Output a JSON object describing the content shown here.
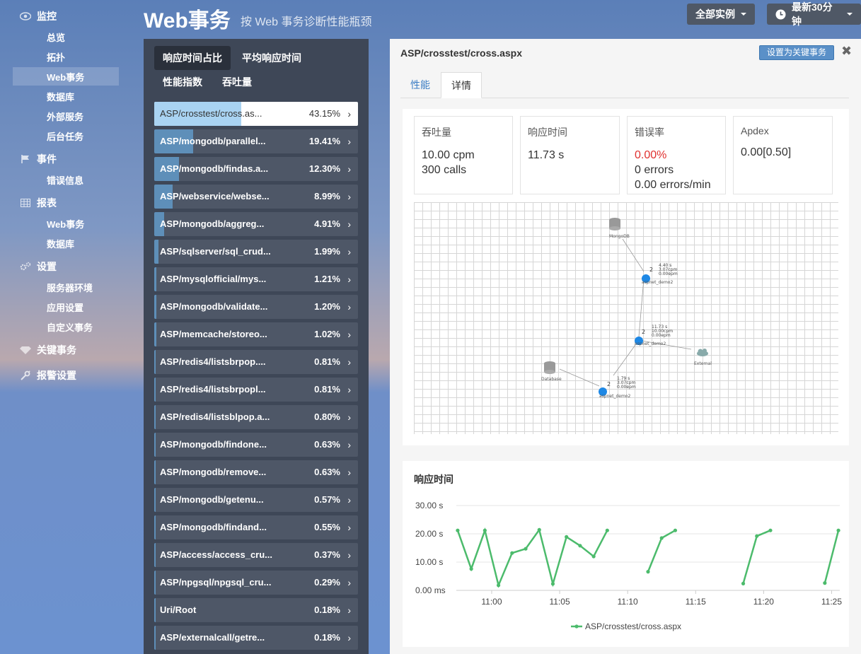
{
  "sidebar": {
    "groups": [
      {
        "label": "监控",
        "icon": "eye-icon"
      },
      {
        "label": "事件",
        "icon": "flag-icon"
      },
      {
        "label": "报表",
        "icon": "table-icon"
      },
      {
        "label": "设置",
        "icon": "gears-icon"
      },
      {
        "label": "关键事务",
        "icon": "diamond-icon"
      },
      {
        "label": "报警设置",
        "icon": "wrench-icon"
      }
    ],
    "items": [
      "总览",
      "拓扑",
      "Web事务",
      "数据库",
      "外部服务",
      "后台任务",
      "错误信息",
      "Web事务",
      "数据库",
      "服务器环境",
      "应用设置",
      "自定义事务"
    ],
    "active_item": "Web事务"
  },
  "header": {
    "title": "Web事务",
    "subtitle": "按 Web 事务诊断性能瓶颈",
    "instances_label": "全部实例",
    "time_label": "最新30分钟"
  },
  "list": {
    "tabs": [
      "响应时间占比",
      "平均响应时间",
      "性能指数",
      "吞吐量"
    ],
    "active_tab": "响应时间占比",
    "rows": [
      {
        "name": "ASP/crosstest/cross.as...",
        "pct": "43.15%",
        "value": 43.15
      },
      {
        "name": "ASP/mongodb/parallel...",
        "pct": "19.41%",
        "value": 19.41
      },
      {
        "name": "ASP/mongodb/findas.a...",
        "pct": "12.30%",
        "value": 12.3
      },
      {
        "name": "ASP/webservice/webse...",
        "pct": "8.99%",
        "value": 8.99
      },
      {
        "name": "ASP/mongodb/aggreg...",
        "pct": "4.91%",
        "value": 4.91
      },
      {
        "name": "ASP/sqlserver/sql_crud...",
        "pct": "1.99%",
        "value": 1.99
      },
      {
        "name": "ASP/mysqlofficial/mys...",
        "pct": "1.21%",
        "value": 1.21
      },
      {
        "name": "ASP/mongodb/validate...",
        "pct": "1.20%",
        "value": 1.2
      },
      {
        "name": "ASP/memcache/storeo...",
        "pct": "1.02%",
        "value": 1.02
      },
      {
        "name": "ASP/redis4/listsbrpop....",
        "pct": "0.81%",
        "value": 0.81
      },
      {
        "name": "ASP/redis4/listsbrpopl...",
        "pct": "0.81%",
        "value": 0.81
      },
      {
        "name": "ASP/redis4/listsblpop.a...",
        "pct": "0.80%",
        "value": 0.8
      },
      {
        "name": "ASP/mongodb/findone...",
        "pct": "0.63%",
        "value": 0.63
      },
      {
        "name": "ASP/mongodb/remove...",
        "pct": "0.63%",
        "value": 0.63
      },
      {
        "name": "ASP/mongodb/getenu...",
        "pct": "0.57%",
        "value": 0.57
      },
      {
        "name": "ASP/mongodb/findand...",
        "pct": "0.55%",
        "value": 0.55
      },
      {
        "name": "ASP/access/access_cru...",
        "pct": "0.37%",
        "value": 0.37
      },
      {
        "name": "ASP/npgsql/npgsql_cru...",
        "pct": "0.29%",
        "value": 0.29
      },
      {
        "name": "Uri/Root",
        "pct": "0.18%",
        "value": 0.18
      },
      {
        "name": "ASP/externalcall/getre...",
        "pct": "0.18%",
        "value": 0.18
      }
    ]
  },
  "detail": {
    "title": "ASP/crosstest/cross.aspx",
    "key_button": "设置为关键事务",
    "tabs": [
      "性能",
      "详情"
    ],
    "active_tab": "详情",
    "metrics": {
      "throughput": {
        "label": "吞吐量",
        "line1": "10.00 cpm",
        "line2": "300 calls"
      },
      "response": {
        "label": "响应时间",
        "line1": "11.73 s"
      },
      "error": {
        "label": "错误率",
        "line1": "0.00%",
        "line2": "0 errors",
        "line3": "0.00 errors/min"
      },
      "apdex": {
        "label": "Apdex",
        "line1": "0.00[0.50]"
      }
    },
    "topology": {
      "nodes": [
        {
          "label": "MongoDB",
          "icon": "database-icon"
        },
        {
          "label": "aspnet_demo2",
          "count": "2",
          "stats": [
            "4.40 s",
            "3.07cpm",
            "0.00epm"
          ]
        },
        {
          "label": "aspnet_demo2",
          "count": "2",
          "stats": [
            "11.73 s",
            "10.00cpm",
            "0.00epm"
          ]
        },
        {
          "label": "External",
          "icon": "cloud-icon"
        },
        {
          "label": "Database",
          "icon": "database-icon"
        },
        {
          "label": "aspnet_demo2",
          "count": "2",
          "stats": [
            "1.79 s",
            "3.07cpm",
            "0.00epm"
          ]
        }
      ]
    },
    "colors": {
      "accent": "#3b7dc4",
      "error": "#e0312f",
      "series": "#4cbb6c",
      "bar": "#5e8fb9"
    }
  },
  "chart_data": {
    "type": "line",
    "title": "响应时间",
    "yticks": [
      "30.00 s",
      "20.00 s",
      "10.00 s",
      "0.00 ms"
    ],
    "ylim": [
      0,
      30
    ],
    "xticks": [
      "11:00",
      "11:05",
      "11:10",
      "11:15",
      "11:20",
      "11:25"
    ],
    "xlim": [
      -2.6,
      25.6
    ],
    "legend_position": "bottom",
    "series": [
      {
        "name": "ASP/crosstest/cross.aspx",
        "segments": [
          [
            [
              -2.5,
              21.2
            ],
            [
              -1.5,
              7.6
            ],
            [
              -0.5,
              21.2
            ],
            [
              0.5,
              1.8
            ],
            [
              1.5,
              13.2
            ],
            [
              2.5,
              14.7
            ],
            [
              3.5,
              21.4
            ],
            [
              4.5,
              2.3
            ],
            [
              5.5,
              18.9
            ],
            [
              6.5,
              15.8
            ],
            [
              7.5,
              12.0
            ],
            [
              8.5,
              21.2
            ]
          ],
          [
            [
              11.5,
              6.6
            ],
            [
              12.5,
              18.5
            ],
            [
              13.5,
              21.2
            ]
          ],
          [
            [
              18.5,
              2.4
            ],
            [
              19.5,
              19.2
            ],
            [
              20.5,
              21.2
            ]
          ],
          [
            [
              24.5,
              2.6
            ],
            [
              25.5,
              21.2
            ]
          ]
        ]
      }
    ]
  }
}
